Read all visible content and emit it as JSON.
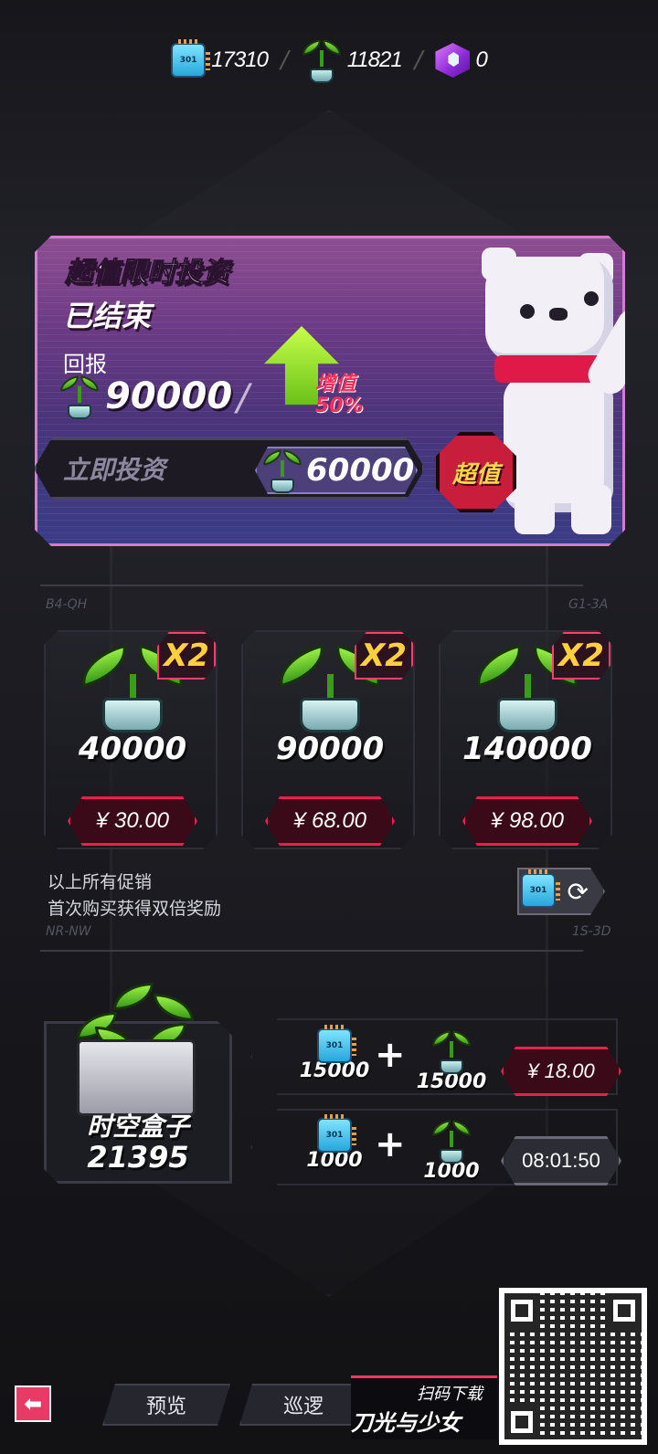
{
  "currency": {
    "chips": "17310",
    "sprouts": "11821",
    "cubes": "0"
  },
  "invest": {
    "title": "超值限时投资",
    "status": "已结束",
    "return_label": "回报",
    "return_value": "90000",
    "bonus_line1": "增值",
    "bonus_line2": "50%",
    "invest_button": "立即投资",
    "cost": "60000",
    "value_badge": "超值"
  },
  "tags": {
    "top_left": "B4-QH",
    "top_right": "G1-3A",
    "bottom_left": "NR-NW",
    "bottom_right": "1S-3D"
  },
  "packs": [
    {
      "multiplier": "X2",
      "amount": "40000",
      "price": "¥ 30.00"
    },
    {
      "multiplier": "X2",
      "amount": "90000",
      "price": "¥ 68.00"
    },
    {
      "multiplier": "X2",
      "amount": "140000",
      "price": "¥ 98.00"
    }
  ],
  "promo_note": {
    "line1": "以上所有促销",
    "line2": "首次购买获得双倍奖励"
  },
  "timebox": {
    "title": "时空盒子",
    "count": "21395"
  },
  "bundles": [
    {
      "chips": "15000",
      "sprouts": "15000",
      "price": "¥ 18.00"
    },
    {
      "chips": "1000",
      "sprouts": "1000",
      "timer": "08:01:50"
    }
  ],
  "nav": {
    "back_icon": "back-arrow-icon",
    "preview": "预览",
    "patrol": "巡逻"
  },
  "promo_footer": {
    "scan": "扫码下载",
    "game": "刀光与少女"
  },
  "chip_label": "301",
  "colors": {
    "accent_red": "#e8204c",
    "banner_purple": "#6b3a85",
    "gold": "#ffd23d"
  }
}
